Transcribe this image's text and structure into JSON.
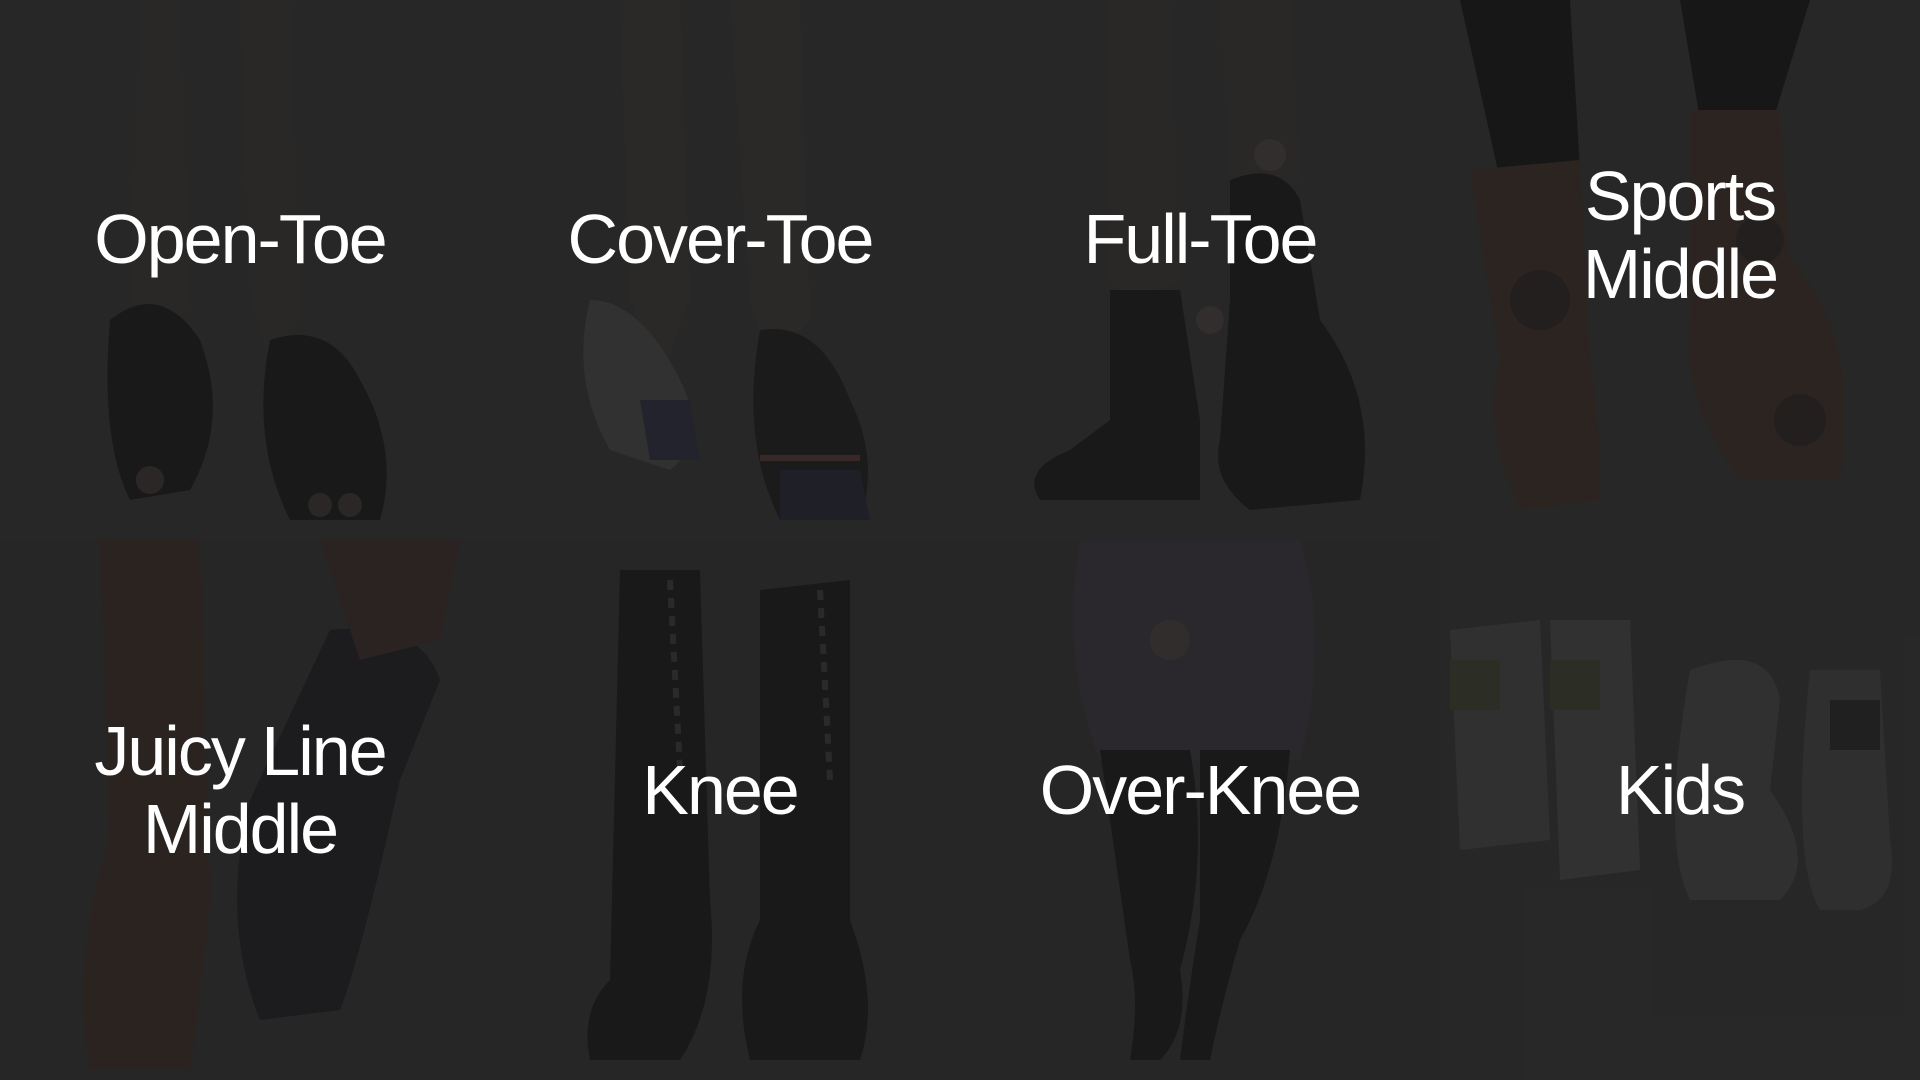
{
  "categories": [
    {
      "label": "Open-Toe",
      "icon": "open-toe-socks-photo"
    },
    {
      "label": "Cover-Toe",
      "icon": "cover-toe-socks-photo"
    },
    {
      "label": "Full-Toe",
      "icon": "full-toe-socks-photo"
    },
    {
      "label": "Sports\nMiddle",
      "icon": "sports-middle-socks-photo"
    },
    {
      "label": "Juicy Line\nMiddle",
      "icon": "juicy-line-middle-socks-photo"
    },
    {
      "label": "Knee",
      "icon": "knee-socks-photo"
    },
    {
      "label": "Over-Knee",
      "icon": "over-knee-socks-photo"
    },
    {
      "label": "Kids",
      "icon": "kids-socks-photo"
    }
  ],
  "colors": {
    "background": "#2a2a2a",
    "label": "#ffffff"
  }
}
